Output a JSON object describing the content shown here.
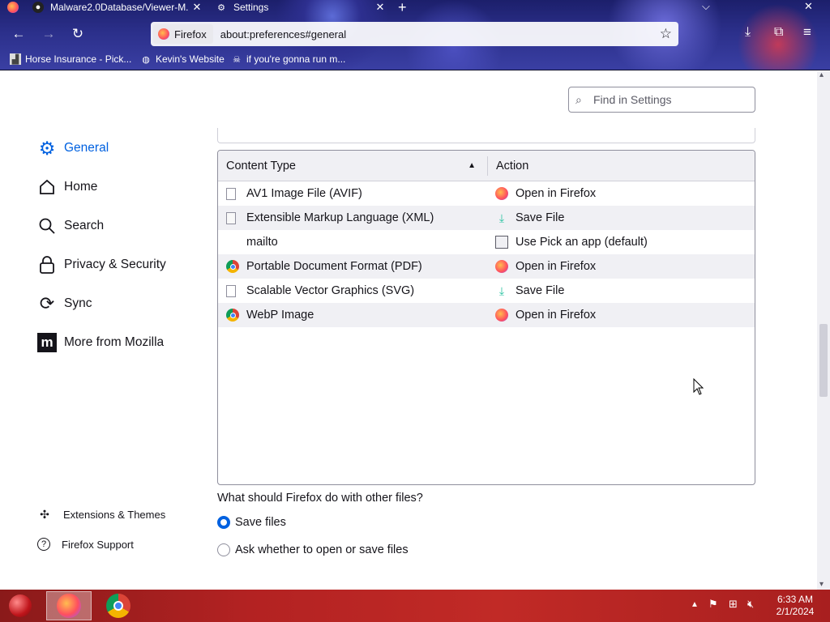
{
  "browser": {
    "tabs": [
      {
        "title": "Malware2.0Database/Viewer-M...",
        "icon": "github-icon"
      },
      {
        "title": "Settings",
        "icon": "gear-icon"
      }
    ],
    "identity_label": "Firefox",
    "url": "about:preferences#general",
    "bookmarks": [
      {
        "label": "Horse Insurance - Pick...",
        "icon": "horse-icon"
      },
      {
        "label": "Kevin's Website",
        "icon": "globe-icon"
      },
      {
        "label": "if you're gonna run m...",
        "icon": "skull-icon"
      }
    ]
  },
  "settings": {
    "search_placeholder": "Find in Settings",
    "nav": [
      {
        "label": "General",
        "icon": "gear-icon",
        "active": true
      },
      {
        "label": "Home",
        "icon": "home-icon"
      },
      {
        "label": "Search",
        "icon": "search-icon"
      },
      {
        "label": "Privacy & Security",
        "icon": "lock-icon"
      },
      {
        "label": "Sync",
        "icon": "sync-icon"
      },
      {
        "label": "More from Mozilla",
        "icon": "mozilla-icon"
      }
    ],
    "footer_links": [
      {
        "label": "Extensions & Themes",
        "icon": "puzzle-icon"
      },
      {
        "label": "Firefox Support",
        "icon": "help-icon"
      }
    ],
    "table": {
      "columns": [
        "Content Type",
        "Action"
      ],
      "rows": [
        {
          "type": "AV1 Image File (AVIF)",
          "type_icon": "file-icon",
          "action": "Open in Firefox",
          "action_icon": "firefox-icon"
        },
        {
          "type": "Extensible Markup Language (XML)",
          "type_icon": "file-icon",
          "action": "Save File",
          "action_icon": "save-icon"
        },
        {
          "type": "mailto",
          "type_icon": "",
          "action": "Use Pick an app (default)",
          "action_icon": "app-icon"
        },
        {
          "type": "Portable Document Format (PDF)",
          "type_icon": "chrome-icon",
          "action": "Open in Firefox",
          "action_icon": "firefox-icon"
        },
        {
          "type": "Scalable Vector Graphics (SVG)",
          "type_icon": "file-icon",
          "action": "Save File",
          "action_icon": "save-icon"
        },
        {
          "type": "WebP Image",
          "type_icon": "chrome-icon",
          "action": "Open in Firefox",
          "action_icon": "firefox-icon"
        }
      ]
    },
    "other_files_question": "What should Firefox do with other files?",
    "radio_options": [
      {
        "label": "Save files",
        "checked": true
      },
      {
        "label": "Ask whether to open or save files",
        "checked": false
      }
    ]
  },
  "taskbar": {
    "time": "6:33 AM",
    "date": "2/1/2024"
  }
}
